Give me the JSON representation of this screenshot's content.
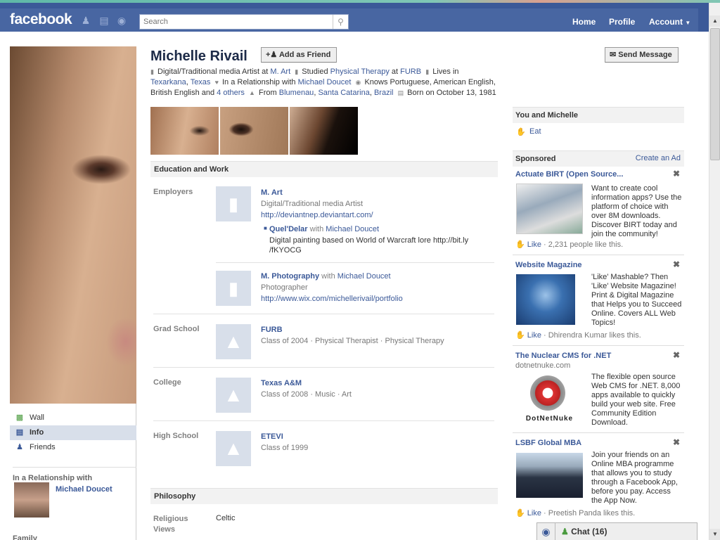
{
  "topbar": {
    "logo": "facebook",
    "search_placeholder": "Search",
    "nav": [
      "Home",
      "Profile",
      "Account"
    ]
  },
  "profile": {
    "name": "Michelle Rivail",
    "add_friend": "Add as Friend",
    "send_message": "Send Message",
    "info": {
      "work_pre": "Digital/Traditional media Artist at",
      "work_link": "M. Art",
      "study_pre": "Studied",
      "study_link1": "Physical Therapy",
      "study_at": "at",
      "study_link2": "FURB",
      "lives_pre": "Lives in",
      "lives_link1": "Texarkana",
      "lives_link2": "Texas",
      "rel_pre": "In a Relationship with",
      "rel_link": "Michael Doucet",
      "knows_pre": "Knows Portuguese, American English, British English and",
      "knows_link": "4 others",
      "from_pre": "From",
      "from_link1": "Blumenau",
      "from_link2": "Santa Catarina",
      "from_link3": "Brazil",
      "born": "Born on October 13, 1981"
    }
  },
  "left_nav": {
    "items": [
      "Wall",
      "Info",
      "Friends"
    ],
    "rel_heading": "In a Relationship with",
    "rel_name": "Michael Doucet",
    "family_heading": "Family"
  },
  "sections": {
    "education_work": "Education and Work",
    "philosophy": "Philosophy"
  },
  "employers": {
    "label": "Employers",
    "items": [
      {
        "title": "M. Art",
        "sub": "Digital/Traditional media Artist",
        "url": "http://deviantnep.deviantart.com/",
        "project": {
          "name": "Quel'Delar",
          "with_pre": "with",
          "with": "Michael Doucet",
          "desc1": "Digital painting based on World of Warcraft lore http://bit.ly",
          "desc2": "/fKYOCG"
        }
      },
      {
        "title": "M. Photography",
        "with_pre": "with",
        "with": "Michael Doucet",
        "sub": "Photographer",
        "url": "http://www.wix.com/michellerivail/portfolio"
      }
    ]
  },
  "grad_school": {
    "label": "Grad School",
    "title": "FURB",
    "sub": "Class of 2004 · Physical Therapist · Physical Therapy"
  },
  "college": {
    "label": "College",
    "title": "Texas A&M",
    "sub": "Class of 2008 · Music · Art"
  },
  "high_school": {
    "label": "High School",
    "title": "ETEVI",
    "sub": "Class of 1999"
  },
  "philosophy": {
    "label": "Religious Views",
    "value": "Celtic"
  },
  "sidebar": {
    "you_and": "You and Michelle",
    "common": "Eat",
    "sponsored": "Sponsored",
    "create_ad": "Create an Ad",
    "ads": [
      {
        "title": "Actuate BIRT (Open Source...",
        "body": "Want to create cool information apps? Use the platform of choice with over 8M downloads. Discover BIRT today and join the community!",
        "like": "Like",
        "likes": "2,231 people like this."
      },
      {
        "title": "Website Magazine",
        "body": "'Like' Mashable? Then 'Like' Website Magazine! Print & Digital Magazine that Helps you to Succeed Online. Covers ALL Web Topics!",
        "like": "Like",
        "likes": "Dhirendra Kumar likes this."
      },
      {
        "title": "The Nuclear CMS for .NET",
        "site": "dotnetnuke.com",
        "body": "The flexible open source Web CMS for .NET. 8,000 apps available to quickly build your web site. Free Community Edition Download.",
        "brand": "DotNetNuke"
      },
      {
        "title": "LSBF Global MBA",
        "body": "Join your friends on an Online MBA programme that allows you to study through a Facebook App, before you pay. Access the App Now.",
        "like": "Like",
        "likes": "Preetish Panda likes this."
      }
    ]
  },
  "chat": {
    "label": "Chat (16)"
  }
}
